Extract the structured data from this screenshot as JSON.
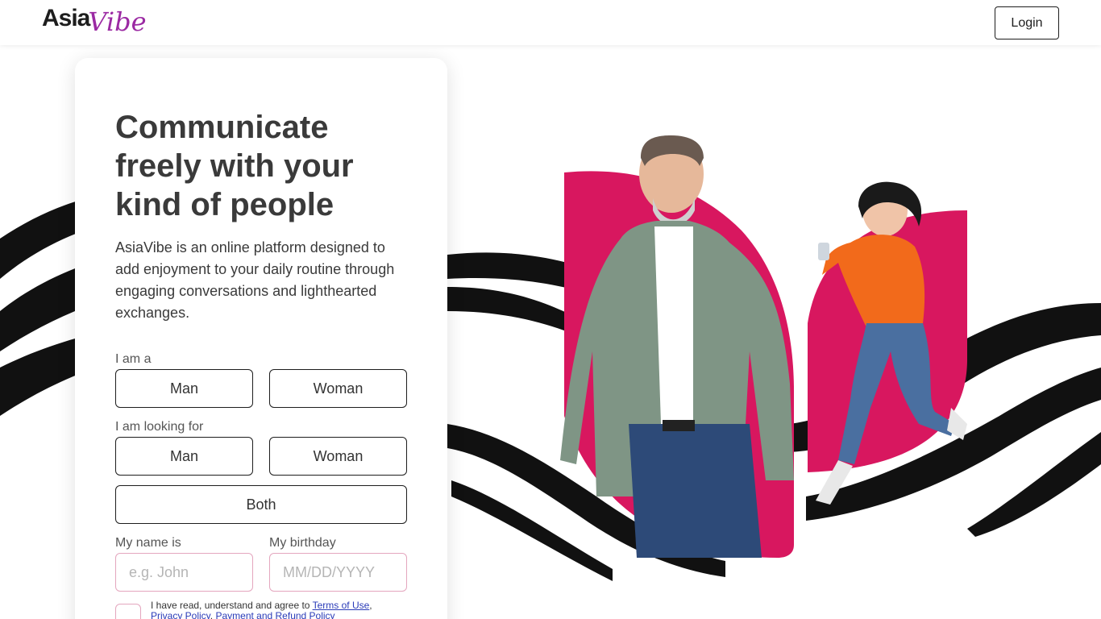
{
  "header": {
    "logo_part1": "Asia",
    "logo_part2": "Vibe",
    "login_label": "Login"
  },
  "form": {
    "title": "Communicate freely with your kind of people",
    "description": "AsiaVibe is an online platform designed to add enjoyment to your daily routine through engaging conversations and lighthearted exchanges.",
    "i_am_label": "I am a",
    "i_am_options": [
      "Man",
      "Woman"
    ],
    "looking_for_label": "I am looking for",
    "looking_for_options": [
      "Man",
      "Woman",
      "Both"
    ],
    "name_label": "My name is",
    "name_placeholder": "e.g. John",
    "birthday_label": "My birthday",
    "birthday_placeholder": "MM/DD/YYYY",
    "terms_prefix": "I have read, understand and agree to ",
    "terms_link1": "Terms of Use",
    "terms_link2": "Privacy Policy",
    "terms_link3": "Payment and Refund Policy"
  },
  "colors": {
    "accent_pink": "#d8175f",
    "logo_purple": "#9b2aa3"
  }
}
